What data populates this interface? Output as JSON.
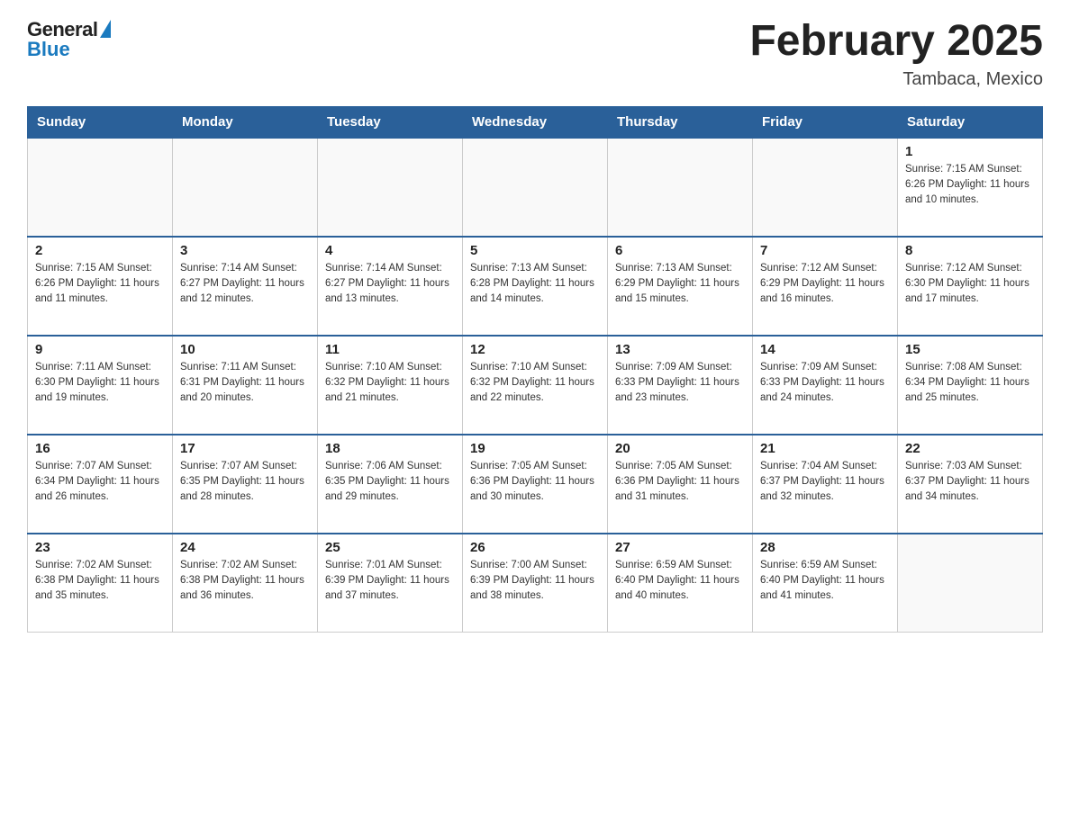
{
  "header": {
    "logo": {
      "general": "General",
      "blue": "Blue"
    },
    "title": "February 2025",
    "location": "Tambaca, Mexico"
  },
  "days_of_week": [
    "Sunday",
    "Monday",
    "Tuesday",
    "Wednesday",
    "Thursday",
    "Friday",
    "Saturday"
  ],
  "weeks": [
    [
      {
        "day": "",
        "info": ""
      },
      {
        "day": "",
        "info": ""
      },
      {
        "day": "",
        "info": ""
      },
      {
        "day": "",
        "info": ""
      },
      {
        "day": "",
        "info": ""
      },
      {
        "day": "",
        "info": ""
      },
      {
        "day": "1",
        "info": "Sunrise: 7:15 AM\nSunset: 6:26 PM\nDaylight: 11 hours\nand 10 minutes."
      }
    ],
    [
      {
        "day": "2",
        "info": "Sunrise: 7:15 AM\nSunset: 6:26 PM\nDaylight: 11 hours\nand 11 minutes."
      },
      {
        "day": "3",
        "info": "Sunrise: 7:14 AM\nSunset: 6:27 PM\nDaylight: 11 hours\nand 12 minutes."
      },
      {
        "day": "4",
        "info": "Sunrise: 7:14 AM\nSunset: 6:27 PM\nDaylight: 11 hours\nand 13 minutes."
      },
      {
        "day": "5",
        "info": "Sunrise: 7:13 AM\nSunset: 6:28 PM\nDaylight: 11 hours\nand 14 minutes."
      },
      {
        "day": "6",
        "info": "Sunrise: 7:13 AM\nSunset: 6:29 PM\nDaylight: 11 hours\nand 15 minutes."
      },
      {
        "day": "7",
        "info": "Sunrise: 7:12 AM\nSunset: 6:29 PM\nDaylight: 11 hours\nand 16 minutes."
      },
      {
        "day": "8",
        "info": "Sunrise: 7:12 AM\nSunset: 6:30 PM\nDaylight: 11 hours\nand 17 minutes."
      }
    ],
    [
      {
        "day": "9",
        "info": "Sunrise: 7:11 AM\nSunset: 6:30 PM\nDaylight: 11 hours\nand 19 minutes."
      },
      {
        "day": "10",
        "info": "Sunrise: 7:11 AM\nSunset: 6:31 PM\nDaylight: 11 hours\nand 20 minutes."
      },
      {
        "day": "11",
        "info": "Sunrise: 7:10 AM\nSunset: 6:32 PM\nDaylight: 11 hours\nand 21 minutes."
      },
      {
        "day": "12",
        "info": "Sunrise: 7:10 AM\nSunset: 6:32 PM\nDaylight: 11 hours\nand 22 minutes."
      },
      {
        "day": "13",
        "info": "Sunrise: 7:09 AM\nSunset: 6:33 PM\nDaylight: 11 hours\nand 23 minutes."
      },
      {
        "day": "14",
        "info": "Sunrise: 7:09 AM\nSunset: 6:33 PM\nDaylight: 11 hours\nand 24 minutes."
      },
      {
        "day": "15",
        "info": "Sunrise: 7:08 AM\nSunset: 6:34 PM\nDaylight: 11 hours\nand 25 minutes."
      }
    ],
    [
      {
        "day": "16",
        "info": "Sunrise: 7:07 AM\nSunset: 6:34 PM\nDaylight: 11 hours\nand 26 minutes."
      },
      {
        "day": "17",
        "info": "Sunrise: 7:07 AM\nSunset: 6:35 PM\nDaylight: 11 hours\nand 28 minutes."
      },
      {
        "day": "18",
        "info": "Sunrise: 7:06 AM\nSunset: 6:35 PM\nDaylight: 11 hours\nand 29 minutes."
      },
      {
        "day": "19",
        "info": "Sunrise: 7:05 AM\nSunset: 6:36 PM\nDaylight: 11 hours\nand 30 minutes."
      },
      {
        "day": "20",
        "info": "Sunrise: 7:05 AM\nSunset: 6:36 PM\nDaylight: 11 hours\nand 31 minutes."
      },
      {
        "day": "21",
        "info": "Sunrise: 7:04 AM\nSunset: 6:37 PM\nDaylight: 11 hours\nand 32 minutes."
      },
      {
        "day": "22",
        "info": "Sunrise: 7:03 AM\nSunset: 6:37 PM\nDaylight: 11 hours\nand 34 minutes."
      }
    ],
    [
      {
        "day": "23",
        "info": "Sunrise: 7:02 AM\nSunset: 6:38 PM\nDaylight: 11 hours\nand 35 minutes."
      },
      {
        "day": "24",
        "info": "Sunrise: 7:02 AM\nSunset: 6:38 PM\nDaylight: 11 hours\nand 36 minutes."
      },
      {
        "day": "25",
        "info": "Sunrise: 7:01 AM\nSunset: 6:39 PM\nDaylight: 11 hours\nand 37 minutes."
      },
      {
        "day": "26",
        "info": "Sunrise: 7:00 AM\nSunset: 6:39 PM\nDaylight: 11 hours\nand 38 minutes."
      },
      {
        "day": "27",
        "info": "Sunrise: 6:59 AM\nSunset: 6:40 PM\nDaylight: 11 hours\nand 40 minutes."
      },
      {
        "day": "28",
        "info": "Sunrise: 6:59 AM\nSunset: 6:40 PM\nDaylight: 11 hours\nand 41 minutes."
      },
      {
        "day": "",
        "info": ""
      }
    ]
  ]
}
